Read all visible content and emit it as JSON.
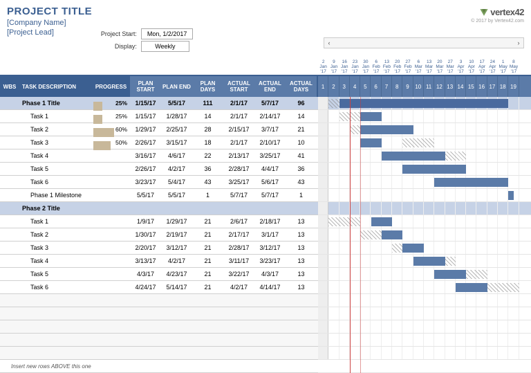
{
  "header": {
    "title": "PROJECT TITLE",
    "company": "[Company Name]",
    "lead": "[Project Lead]",
    "start_label": "Project Start:",
    "start_value": "Mon, 1/2/2017",
    "display_label": "Display:",
    "display_value": "Weekly",
    "logo_text": "vertex42",
    "copyright": "© 2017 by Vertex42.com"
  },
  "columns": {
    "wbs": "WBS",
    "task": "TASK DESCRIPTION",
    "progress": "PROGRESS",
    "plan_start": "PLAN START",
    "plan_end": "PLAN END",
    "plan_days": "PLAN DAYS",
    "actual_start": "ACTUAL START",
    "actual_end": "ACTUAL END",
    "actual_days": "ACTUAL DAYS"
  },
  "timeline": {
    "dates": [
      {
        "d": "2",
        "m": "Jan",
        "y": "'17"
      },
      {
        "d": "9",
        "m": "Jan",
        "y": "'17"
      },
      {
        "d": "16",
        "m": "Jan",
        "y": "'17"
      },
      {
        "d": "23",
        "m": "Jan",
        "y": "'17"
      },
      {
        "d": "30",
        "m": "Jan",
        "y": "'17"
      },
      {
        "d": "6",
        "m": "Feb",
        "y": "'17"
      },
      {
        "d": "13",
        "m": "Feb",
        "y": "'17"
      },
      {
        "d": "20",
        "m": "Feb",
        "y": "'17"
      },
      {
        "d": "27",
        "m": "Feb",
        "y": "'17"
      },
      {
        "d": "6",
        "m": "Mar",
        "y": "'17"
      },
      {
        "d": "13",
        "m": "Mar",
        "y": "'17"
      },
      {
        "d": "20",
        "m": "Mar",
        "y": "'17"
      },
      {
        "d": "27",
        "m": "Mar",
        "y": "'17"
      },
      {
        "d": "3",
        "m": "Apr",
        "y": "'17"
      },
      {
        "d": "10",
        "m": "Apr",
        "y": "'17"
      },
      {
        "d": "17",
        "m": "Apr",
        "y": "'17"
      },
      {
        "d": "24",
        "m": "Apr",
        "y": "'17"
      },
      {
        "d": "1",
        "m": "May",
        "y": "'17"
      },
      {
        "d": "8",
        "m": "May",
        "y": "'17"
      }
    ],
    "weeks": [
      "1",
      "2",
      "3",
      "4",
      "5",
      "6",
      "7",
      "8",
      "9",
      "10",
      "11",
      "12",
      "13",
      "14",
      "15",
      "16",
      "17",
      "18",
      "19"
    ]
  },
  "rows": [
    {
      "type": "phase",
      "task": "Phase 1 Title",
      "progress": 25,
      "ps": "1/15/17",
      "pe": "5/5/17",
      "pd": "111",
      "as": "2/1/17",
      "ae": "5/7/17",
      "ad": "96",
      "bar_start": 2,
      "bar_len": 16,
      "hatch_start": 1,
      "hatch_len": 3
    },
    {
      "type": "task",
      "task": "Task 1",
      "progress": 25,
      "ps": "1/15/17",
      "pe": "1/28/17",
      "pd": "14",
      "as": "2/1/17",
      "ae": "2/14/17",
      "ad": "14",
      "bar_start": 4,
      "bar_len": 2,
      "hatch_start": 2,
      "hatch_len": 2
    },
    {
      "type": "task",
      "task": "Task 2",
      "progress": 60,
      "ps": "1/29/17",
      "pe": "2/25/17",
      "pd": "28",
      "as": "2/15/17",
      "ae": "3/7/17",
      "ad": "21",
      "bar_start": 4,
      "bar_len": 5,
      "hatch_start": 3,
      "hatch_len": 4
    },
    {
      "type": "task",
      "task": "Task 3",
      "progress": 50,
      "ps": "2/26/17",
      "pe": "3/15/17",
      "pd": "18",
      "as": "2/1/17",
      "ae": "2/10/17",
      "ad": "10",
      "bar_start": 4,
      "bar_len": 2,
      "hatch_start": 8,
      "hatch_len": 3
    },
    {
      "type": "task",
      "task": "Task 4",
      "progress": null,
      "ps": "3/16/17",
      "pe": "4/6/17",
      "pd": "22",
      "as": "2/13/17",
      "ae": "3/25/17",
      "ad": "41",
      "bar_start": 6,
      "bar_len": 6,
      "hatch_start": 10,
      "hatch_len": 4
    },
    {
      "type": "task",
      "task": "Task 5",
      "progress": null,
      "ps": "2/26/17",
      "pe": "4/2/17",
      "pd": "36",
      "as": "2/28/17",
      "ae": "4/4/17",
      "ad": "36",
      "bar_start": 8,
      "bar_len": 6,
      "hatch_start": 8,
      "hatch_len": 2
    },
    {
      "type": "task",
      "task": "Task 6",
      "progress": null,
      "ps": "3/23/17",
      "pe": "5/4/17",
      "pd": "43",
      "as": "3/25/17",
      "ae": "5/6/17",
      "ad": "43",
      "bar_start": 11,
      "bar_len": 7,
      "hatch_start": 11,
      "hatch_len": 1
    },
    {
      "type": "task",
      "task": "Phase 1 Milestone",
      "progress": null,
      "ps": "5/5/17",
      "pe": "5/5/17",
      "pd": "1",
      "as": "5/7/17",
      "ae": "5/7/17",
      "ad": "1",
      "bar_start": 18,
      "bar_len": 0.5,
      "hatch_start": 0,
      "hatch_len": 0
    },
    {
      "type": "phase",
      "task": "Phase 2 Title",
      "progress": null,
      "ps": "",
      "pe": "",
      "pd": "",
      "as": "",
      "ae": "",
      "ad": "",
      "bar_start": 0,
      "bar_len": 0,
      "hatch_start": 0,
      "hatch_len": 0
    },
    {
      "type": "task",
      "task": "Task 1",
      "progress": null,
      "ps": "1/9/17",
      "pe": "1/29/17",
      "pd": "21",
      "as": "2/6/17",
      "ae": "2/18/17",
      "ad": "13",
      "bar_start": 5,
      "bar_len": 2,
      "hatch_start": 1,
      "hatch_len": 3
    },
    {
      "type": "task",
      "task": "Task 2",
      "progress": null,
      "ps": "1/30/17",
      "pe": "2/19/17",
      "pd": "21",
      "as": "2/17/17",
      "ae": "3/1/17",
      "ad": "13",
      "bar_start": 6,
      "bar_len": 2,
      "hatch_start": 4,
      "hatch_len": 3
    },
    {
      "type": "task",
      "task": "Task 3",
      "progress": null,
      "ps": "2/20/17",
      "pe": "3/12/17",
      "pd": "21",
      "as": "2/28/17",
      "ae": "3/12/17",
      "ad": "13",
      "bar_start": 8,
      "bar_len": 2,
      "hatch_start": 7,
      "hatch_len": 3
    },
    {
      "type": "task",
      "task": "Task 4",
      "progress": null,
      "ps": "3/13/17",
      "pe": "4/2/17",
      "pd": "21",
      "as": "3/11/17",
      "ae": "3/23/17",
      "ad": "13",
      "bar_start": 9,
      "bar_len": 3,
      "hatch_start": 10,
      "hatch_len": 3
    },
    {
      "type": "task",
      "task": "Task 5",
      "progress": null,
      "ps": "4/3/17",
      "pe": "4/23/17",
      "pd": "21",
      "as": "3/22/17",
      "ae": "4/3/17",
      "ad": "13",
      "bar_start": 11,
      "bar_len": 3,
      "hatch_start": 13,
      "hatch_len": 3
    },
    {
      "type": "task",
      "task": "Task 6",
      "progress": null,
      "ps": "4/24/17",
      "pe": "5/14/17",
      "pd": "21",
      "as": "4/2/17",
      "ae": "4/14/17",
      "ad": "13",
      "bar_start": 13,
      "bar_len": 3,
      "hatch_start": 16,
      "hatch_len": 3
    }
  ],
  "note": "Insert new rows ABOVE this one",
  "chart_data": {
    "type": "gantt",
    "title": "PROJECT TITLE",
    "x_unit": "week",
    "x_start": "2017-01-02",
    "weeks": 19,
    "today_week": 4,
    "series": [
      {
        "name": "Phase 1 Title",
        "plan": [
          3,
          18
        ],
        "actual": [
          5,
          19
        ],
        "progress": 25
      },
      {
        "name": "Task 1",
        "plan": [
          3,
          4
        ],
        "actual": [
          5,
          7
        ],
        "progress": 25
      },
      {
        "name": "Task 2",
        "plan": [
          4,
          8
        ],
        "actual": [
          7,
          10
        ],
        "progress": 60
      },
      {
        "name": "Task 3",
        "plan": [
          8,
          11
        ],
        "actual": [
          5,
          6
        ],
        "progress": 50
      },
      {
        "name": "Task 4",
        "plan": [
          11,
          14
        ],
        "actual": [
          7,
          12
        ],
        "progress": null
      },
      {
        "name": "Task 5",
        "plan": [
          8,
          14
        ],
        "actual": [
          9,
          14
        ],
        "progress": null
      },
      {
        "name": "Task 6",
        "plan": [
          12,
          18
        ],
        "actual": [
          12,
          19
        ],
        "progress": null
      },
      {
        "name": "Phase 1 Milestone",
        "plan": [
          18,
          18
        ],
        "actual": [
          19,
          19
        ],
        "progress": null
      },
      {
        "name": "Task 1",
        "plan": [
          2,
          4
        ],
        "actual": [
          6,
          7
        ],
        "progress": null
      },
      {
        "name": "Task 2",
        "plan": [
          5,
          7
        ],
        "actual": [
          7,
          9
        ],
        "progress": null
      },
      {
        "name": "Task 3",
        "plan": [
          8,
          10
        ],
        "actual": [
          9,
          10
        ],
        "progress": null
      },
      {
        "name": "Task 4",
        "plan": [
          11,
          13
        ],
        "actual": [
          10,
          12
        ],
        "progress": null
      },
      {
        "name": "Task 5",
        "plan": [
          14,
          16
        ],
        "actual": [
          12,
          14
        ],
        "progress": null
      },
      {
        "name": "Task 6",
        "plan": [
          17,
          19
        ],
        "actual": [
          14,
          16
        ],
        "progress": null
      }
    ]
  }
}
